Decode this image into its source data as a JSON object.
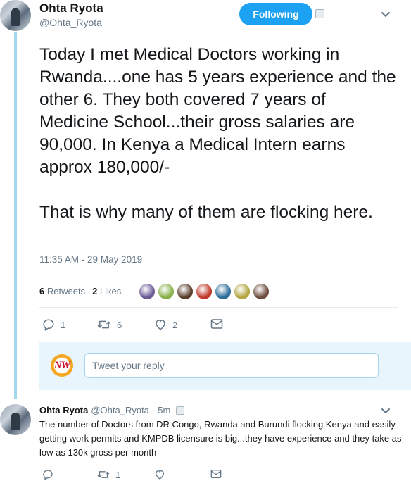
{
  "main_tweet": {
    "author_name": "Ohta Ryota",
    "author_handle": "@Ohta_Ryota",
    "follow_button_label": "Following",
    "text": "Today I met Medical Doctors working in Rwanda....one has 5 years experience and the other 6. They both covered 7 years of Medicine School...their gross salaries are 90,000. In Kenya a Medical Intern earns approx 180,000/-\n\nThat is why many of them are flocking here.",
    "timestamp": "11:35 AM - 29 May 2019",
    "retweets_count": "6",
    "retweets_label": "Retweets",
    "likes_count": "2",
    "likes_label": "Likes",
    "actions": {
      "reply_count": "1",
      "retweet_count": "6",
      "like_count": "2"
    }
  },
  "liker_avatar_colors": [
    "#6b5b95",
    "#88b04b",
    "#5a3e2b",
    "#c0392b",
    "#2c6e9b",
    "#b5a642",
    "#6d4c3d"
  ],
  "compose": {
    "avatar_text": "NW",
    "placeholder": "Tweet your reply"
  },
  "reply_tweet": {
    "author_name": "Ohta Ryota",
    "author_handle": "@Ohta_Ryota",
    "separator": "·",
    "time": "5m",
    "text": "The number of Doctors from DR Congo, Rwanda and Burundi flocking Kenya and easily getting work permits and KMPDB licensure is big...they have experience and they take as low as 130k gross per month",
    "retweet_count": "1"
  },
  "colors": {
    "accent": "#1da1f2",
    "thread_line": "#a3d7ee",
    "secondary_text": "#657786"
  }
}
